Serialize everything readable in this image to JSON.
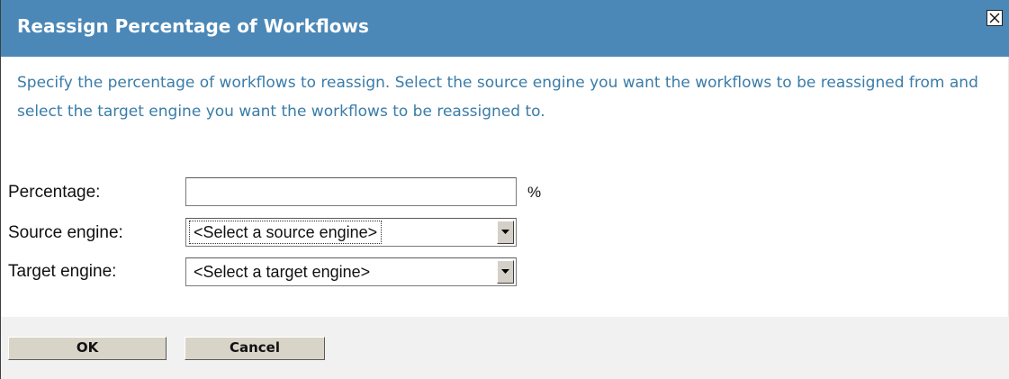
{
  "dialog": {
    "title": "Reassign Percentage of Workflows",
    "close_icon": "close-icon",
    "instructions": "Specify the percentage of workflows to reassign.  Select the source engine you want the workflows to be reassigned from and select the target engine you want the workflows to be reassigned to."
  },
  "form": {
    "percentage": {
      "label": "Percentage:",
      "value": "",
      "unit": "%"
    },
    "source_engine": {
      "label": "Source engine:",
      "selected": "<Select a source engine>"
    },
    "target_engine": {
      "label": "Target engine:",
      "selected": "<Select a target engine>"
    }
  },
  "buttons": {
    "ok": "OK",
    "cancel": "Cancel"
  },
  "colors": {
    "title_bar": "#4b88b7",
    "instruction_text": "#3a7ca8",
    "footer": "#f1f1f1",
    "button_face": "#d8d4c8"
  }
}
